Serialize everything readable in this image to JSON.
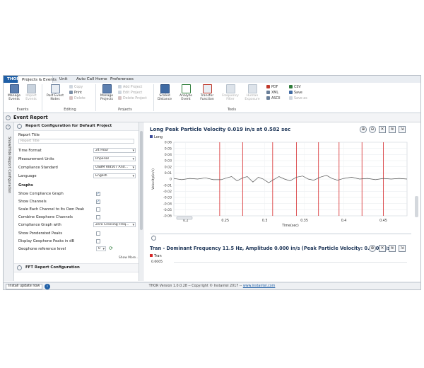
{
  "tabs": [
    {
      "label": "THOR",
      "kind": "app"
    },
    {
      "label": "Projects & Events",
      "kind": "active"
    },
    {
      "label": "Unit",
      "kind": ""
    },
    {
      "label": "Auto Call Home",
      "kind": ""
    },
    {
      "label": "Preferences",
      "kind": ""
    }
  ],
  "ribbon": {
    "events": {
      "label": "Events",
      "manage": "Manage Events",
      "import": "Import Events"
    },
    "editing": {
      "label": "Editing",
      "post": "Post Event Notes",
      "copy": "Copy",
      "print": "Print",
      "delete": "Delete"
    },
    "projects": {
      "label": "Projects",
      "manage": "Manage Projects",
      "add": "Add Project",
      "edit": "Edit Project",
      "delete": "Delete Project"
    },
    "tools": {
      "label": "Tools",
      "scaled": "Scaled Distance",
      "analyze": "Analyze Event",
      "transfer": "Transfer Function",
      "frequency": "Frequency Filter",
      "human": "Human Exposure",
      "pdf": "PDF",
      "xml": "XML",
      "ascii": "ASCII",
      "csv": "CSV",
      "save": "Save",
      "saveas": "Save as"
    }
  },
  "event_report": {
    "title": "Event Report"
  },
  "side_tab": "Show/Hide Report Configuration",
  "config": {
    "header": "Report Configuration for Default Project",
    "report_title_label": "Report Title",
    "report_title_placeholder": "Report Title",
    "time_format": {
      "label": "Time Format",
      "value": "24 Hour"
    },
    "measurement_units": {
      "label": "Measurement Units",
      "value": "Imperial"
    },
    "compliance_standard": {
      "label": "Compliance Standard",
      "value": "USBM RI8507 And..."
    },
    "language": {
      "label": "Language",
      "value": "English"
    },
    "graphs_label": "Graphs",
    "show_compliance": {
      "label": "Show Compliance Graph",
      "checked": true
    },
    "show_channels": {
      "label": "Show Channels",
      "checked": true
    },
    "scale_each": {
      "label": "Scale Each Channel to Its Own Peak",
      "checked": false
    },
    "combine_geophone": {
      "label": "Combine Geophone Channels",
      "checked": false
    },
    "compliance_with": {
      "label": "Compliance Graph with",
      "value": "Zero Crossing Freq..."
    },
    "show_ponderated": {
      "label": "Show Ponderated Peaks",
      "checked": false
    },
    "display_db": {
      "label": "Display Geophone Peaks in dB",
      "checked": false
    },
    "geophone_ref": {
      "label": "Geophone reference level",
      "value": "0"
    },
    "show_more": "Show More..",
    "fft_header": "FFT Report Configuration"
  },
  "chart1": {
    "title": "Long Peak Particle Velocity 0.019 in/s at 0.582 sec",
    "legend": "Long",
    "color": "#3b4a9a",
    "marker_color": "#d62728"
  },
  "chart2": {
    "title": "Tran - Dominant Frequency 11.5 Hz, Amplitude 0.000 in/s (Peak Particle Velocity: 0.010 in/s)",
    "legend": "Tran",
    "color": "#d62728",
    "y_tick_visible": "0.0005"
  },
  "chart_data": [
    {
      "type": "line",
      "title": "Long Peak Particle Velocity 0.019 in/s at 0.582 sec",
      "xlabel": "Time(sec)",
      "ylabel": "Velocity(in/s)",
      "xlim": [
        0.185,
        0.48
      ],
      "ylim": [
        -0.06,
        0.06
      ],
      "x_ticks": [
        "0.2",
        "0.25",
        "0.3",
        "0.35",
        "0.4",
        "0.45"
      ],
      "y_ticks": [
        "0.06",
        "0.05",
        "0.04",
        "0.03",
        "0.02",
        "0.01",
        "0",
        "-0.01",
        "-0.02",
        "-0.03",
        "-0.04",
        "-0.05",
        "-0.06"
      ],
      "vertical_markers": [
        0.243,
        0.272,
        0.31,
        0.34,
        0.368,
        0.394,
        0.423,
        0.45
      ],
      "series": [
        {
          "name": "Long",
          "x": [
            0.185,
            0.195,
            0.205,
            0.215,
            0.225,
            0.235,
            0.245,
            0.252,
            0.258,
            0.265,
            0.272,
            0.278,
            0.285,
            0.292,
            0.298,
            0.305,
            0.31,
            0.318,
            0.325,
            0.332,
            0.34,
            0.348,
            0.355,
            0.362,
            0.37,
            0.378,
            0.385,
            0.392,
            0.4,
            0.41,
            0.42,
            0.43,
            0.44,
            0.45,
            0.46,
            0.47,
            0.48
          ],
          "y": [
            0.001,
            -0.001,
            0.001,
            0.0,
            0.002,
            -0.001,
            -0.001,
            0.002,
            0.004,
            -0.003,
            0.002,
            0.004,
            -0.005,
            0.003,
            0.0,
            -0.006,
            -0.002,
            0.004,
            0.0,
            -0.003,
            0.003,
            0.005,
            0.0,
            -0.002,
            0.003,
            0.006,
            0.001,
            -0.002,
            0.001,
            0.003,
            0.0,
            0.001,
            -0.001,
            0.001,
            0.0,
            0.001,
            0.0
          ]
        }
      ],
      "grid": true,
      "legend": "top-left"
    },
    {
      "type": "line",
      "title": "Tran - Dominant Frequency 11.5 Hz, Amplitude 0.000 in/s (Peak Particle Velocity: 0.010 in/s)",
      "series": [
        {
          "name": "Tran"
        }
      ],
      "y_ticks": [
        "0.0005"
      ]
    }
  ],
  "status": {
    "install": "Install update now",
    "version": "THOR Version 1.0.0.28 -- Copyright © Instantel 2017 --",
    "link": "www.instantel.com"
  }
}
